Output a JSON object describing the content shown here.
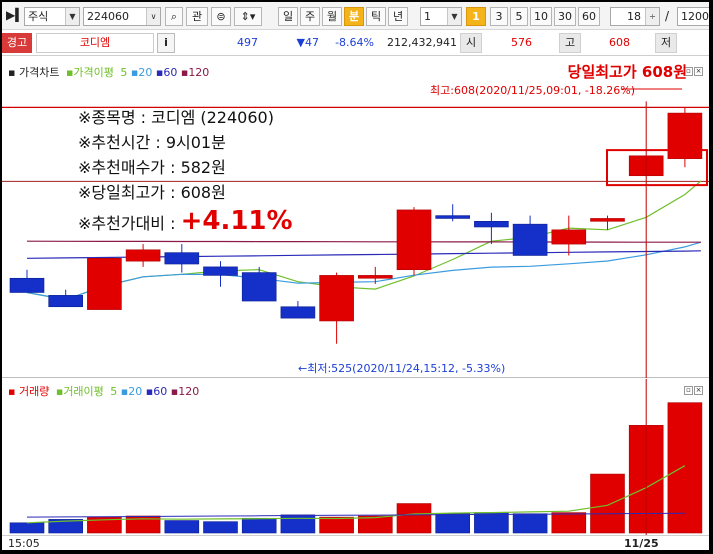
{
  "toolbar": {
    "market": "주식",
    "code": "224060",
    "btn_watch": "관",
    "periods": [
      "일",
      "주",
      "월",
      "분",
      "틱",
      "년"
    ],
    "selected_period": "분",
    "interval_value": "1",
    "minute_options": [
      "1",
      "3",
      "5",
      "10",
      "30",
      "60"
    ],
    "selected_minute": "1",
    "count_value": "18",
    "slash": "/",
    "total_value": "1200"
  },
  "quote": {
    "warning_label": "경고",
    "name": "코디엠",
    "info_btn": "i",
    "price": "497",
    "change": "▼47",
    "change_pct": "-8.64%",
    "volume": "212,432,941",
    "open_label": "시",
    "open": "576",
    "high_label": "고",
    "high": "608",
    "low_label": "저"
  },
  "price_panel": {
    "legend_title": "가격차트",
    "legend_ma_label": "가격이평",
    "legend_ma_periods": [
      "5",
      "20",
      "60",
      "120"
    ],
    "title_annotation": "당일최고가 608원",
    "high_marker": "최고:608(2020/11/25,09:01, -18.26%)",
    "low_marker": "←최저:525(2020/11/24,15:12, -5.33%)",
    "info_lines": [
      "※종목명 : 코디엠 (224060)",
      "※추천시간 : 9시01분",
      "※추천매수가 : 582원",
      "※당일최고가 : 608원"
    ],
    "ratio_label": "※추천가대비 :",
    "ratio_value": "+4.11%"
  },
  "volume_panel": {
    "legend_title": "거래량",
    "legend_ma_label": "거래이평",
    "legend_ma_periods": [
      "5",
      "20",
      "60",
      "120"
    ]
  },
  "xaxis": {
    "left_label": "15:05",
    "right_label": "11/25"
  },
  "colors": {
    "up": "#e00000",
    "down": "#1530c8",
    "ma5": "#6fbf2a",
    "ma20": "#3b9be0",
    "ma60": "#2a2ab8",
    "ma120": "#8b1a4a"
  },
  "chart_data": [
    {
      "type": "candlestick",
      "title": "가격차트",
      "series": [
        {
          "o": 548,
          "h": 551,
          "l": 543,
          "c": 543
        },
        {
          "o": 542,
          "h": 544,
          "l": 538,
          "c": 538
        },
        {
          "o": 537,
          "h": 555,
          "l": 537,
          "c": 555
        },
        {
          "o": 554,
          "h": 560,
          "l": 552,
          "c": 558
        },
        {
          "o": 557,
          "h": 560,
          "l": 550,
          "c": 553
        },
        {
          "o": 552,
          "h": 554,
          "l": 545,
          "c": 549
        },
        {
          "o": 550,
          "h": 552,
          "l": 540,
          "c": 540
        },
        {
          "o": 538,
          "h": 540,
          "l": 534,
          "c": 534
        },
        {
          "o": 533,
          "h": 550,
          "l": 525,
          "c": 549
        },
        {
          "o": 548,
          "h": 552,
          "l": 546,
          "c": 549
        },
        {
          "o": 551,
          "h": 573,
          "l": 549,
          "c": 572
        },
        {
          "o": 570,
          "h": 574,
          "l": 568,
          "c": 569
        },
        {
          "o": 568,
          "h": 571,
          "l": 560,
          "c": 566
        },
        {
          "o": 567,
          "h": 570,
          "l": 556,
          "c": 556
        },
        {
          "o": 560,
          "h": 570,
          "l": 556,
          "c": 565
        },
        {
          "o": 568,
          "h": 570,
          "l": 565,
          "c": 569
        },
        {
          "o": 584,
          "h": 591,
          "l": 584,
          "c": 591
        },
        {
          "o": 590,
          "h": 608,
          "l": 587,
          "c": 606
        }
      ],
      "ylim": [
        520,
        612
      ]
    },
    {
      "type": "bar",
      "title": "거래량",
      "values": [
        9,
        12,
        14,
        15,
        11,
        10,
        13,
        16,
        14,
        15,
        26,
        17,
        18,
        17,
        18,
        52,
        95,
        115
      ],
      "ylim": [
        0,
        120
      ]
    }
  ]
}
